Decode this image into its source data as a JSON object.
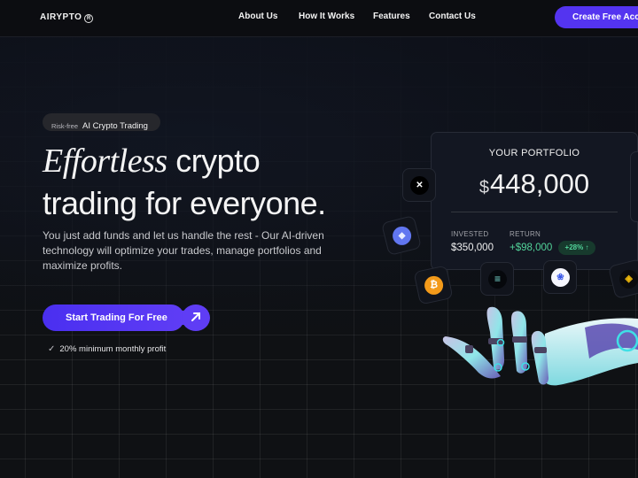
{
  "header": {
    "logo": "AIRYPTO",
    "logo_mark": "R",
    "nav": [
      "About Us",
      "How It Works",
      "Features",
      "Contact Us"
    ],
    "cta": "Create Free Account"
  },
  "hero": {
    "badge_small": "Risk-free",
    "badge_main": "AI Crypto Trading",
    "headline_italic": "Effortless",
    "headline_rest1": " crypto",
    "headline_line2": "trading for everyone.",
    "subtext": "You just add funds and let us handle the rest - Our AI-driven technology will optimize your trades, manage portfolios and maximize profits.",
    "cta": "Start Trading For Free",
    "cta_icon": "arrow-up-right-icon",
    "perk": "20% minimum monthly profit"
  },
  "portfolio": {
    "title": "YOUR PORTFOLIO",
    "currency": "$",
    "value": "448,000",
    "invested_label": "INVESTED",
    "invested_value": "$350,000",
    "return_label": "RETURN",
    "return_value": "+$98,000",
    "return_pct": "+28% ↑"
  },
  "coins": [
    {
      "name": "x-coin",
      "glyph": "✕"
    },
    {
      "name": "ethereum",
      "glyph": "◆"
    },
    {
      "name": "bitcoin",
      "glyph": "₿"
    },
    {
      "name": "solana",
      "glyph": "≡"
    },
    {
      "name": "cardano",
      "glyph": "❀"
    },
    {
      "name": "binance",
      "glyph": "◈"
    }
  ],
  "colors": {
    "accent": "#5434f0",
    "positive": "#52d49a",
    "background": "#0d1019"
  }
}
